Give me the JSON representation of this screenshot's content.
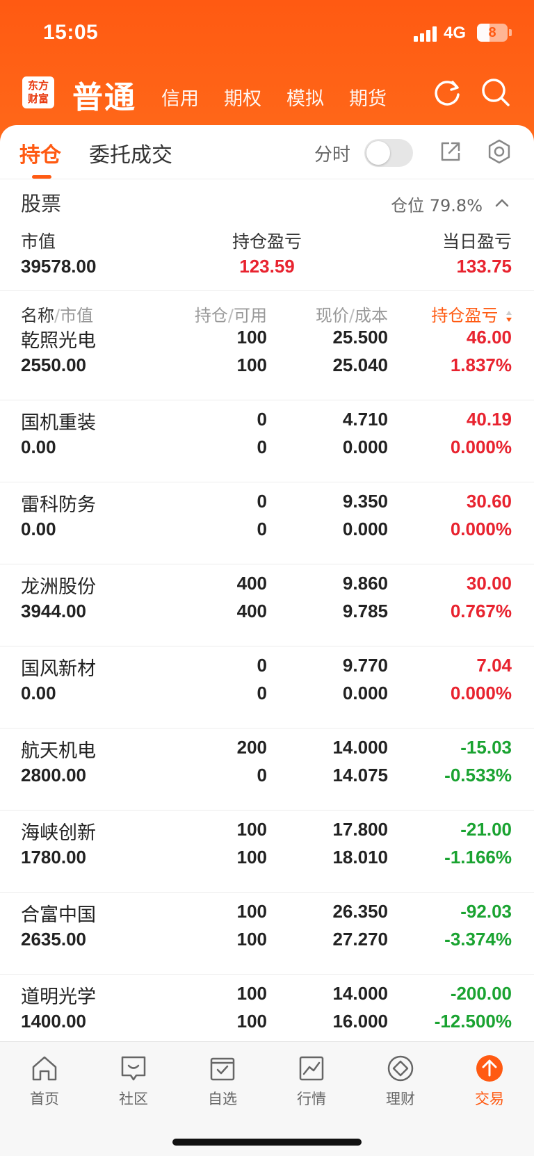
{
  "status": {
    "time": "15:05",
    "network": "4G",
    "battery": "8"
  },
  "app": {
    "logo_line1": "东方",
    "logo_line2": "财富",
    "current_account": "普通",
    "account_tabs": [
      "信用",
      "期权",
      "模拟",
      "期货"
    ]
  },
  "tabs": {
    "holdings": "持仓",
    "orders": "委托成交",
    "fenshi_label": "分时"
  },
  "section": {
    "title": "股票",
    "position": "仓位 79.8%"
  },
  "summary": {
    "market_value_label": "市值",
    "market_value": "39578.00",
    "holding_pl_label": "持仓盈亏",
    "holding_pl": "123.59",
    "today_pl_label": "当日盈亏",
    "today_pl": "133.75"
  },
  "columns": {
    "name": "名称",
    "mv": "市值",
    "hold": "持仓",
    "avail": "可用",
    "price": "现价",
    "cost": "成本",
    "pl": "持仓盈亏"
  },
  "holdings": [
    {
      "name": "乾照光电",
      "mv": "2550.00",
      "hold": "100",
      "avail": "100",
      "price": "25.500",
      "cost": "25.040",
      "pl": "46.00",
      "pct": "1.837%",
      "trend": "up"
    },
    {
      "name": "国机重装",
      "mv": "0.00",
      "hold": "0",
      "avail": "0",
      "price": "4.710",
      "cost": "0.000",
      "pl": "40.19",
      "pct": "0.000%",
      "trend": "up"
    },
    {
      "name": "雷科防务",
      "mv": "0.00",
      "hold": "0",
      "avail": "0",
      "price": "9.350",
      "cost": "0.000",
      "pl": "30.60",
      "pct": "0.000%",
      "trend": "up"
    },
    {
      "name": "龙洲股份",
      "mv": "3944.00",
      "hold": "400",
      "avail": "400",
      "price": "9.860",
      "cost": "9.785",
      "pl": "30.00",
      "pct": "0.767%",
      "trend": "up"
    },
    {
      "name": "国风新材",
      "mv": "0.00",
      "hold": "0",
      "avail": "0",
      "price": "9.770",
      "cost": "0.000",
      "pl": "7.04",
      "pct": "0.000%",
      "trend": "up"
    },
    {
      "name": "航天机电",
      "mv": "2800.00",
      "hold": "200",
      "avail": "0",
      "price": "14.000",
      "cost": "14.075",
      "pl": "-15.03",
      "pct": "-0.533%",
      "trend": "down"
    },
    {
      "name": "海峡创新",
      "mv": "1780.00",
      "hold": "100",
      "avail": "100",
      "price": "17.800",
      "cost": "18.010",
      "pl": "-21.00",
      "pct": "-1.166%",
      "trend": "down"
    },
    {
      "name": "合富中国",
      "mv": "2635.00",
      "hold": "100",
      "avail": "100",
      "price": "26.350",
      "cost": "27.270",
      "pl": "-92.03",
      "pct": "-3.374%",
      "trend": "down"
    },
    {
      "name": "道明光学",
      "mv": "1400.00",
      "hold": "100",
      "avail": "100",
      "price": "14.000",
      "cost": "16.000",
      "pl": "-200.00",
      "pct": "-12.500%",
      "trend": "down"
    }
  ],
  "bottom_nav": [
    {
      "label": "首页",
      "icon": "home-icon"
    },
    {
      "label": "社区",
      "icon": "community-icon"
    },
    {
      "label": "自选",
      "icon": "watchlist-icon"
    },
    {
      "label": "行情",
      "icon": "market-icon"
    },
    {
      "label": "理财",
      "icon": "wealth-icon"
    },
    {
      "label": "交易",
      "icon": "trade-icon",
      "active": true
    }
  ],
  "colors": {
    "brand": "#ff5a12",
    "up": "#e8232f",
    "down": "#1aa331"
  }
}
